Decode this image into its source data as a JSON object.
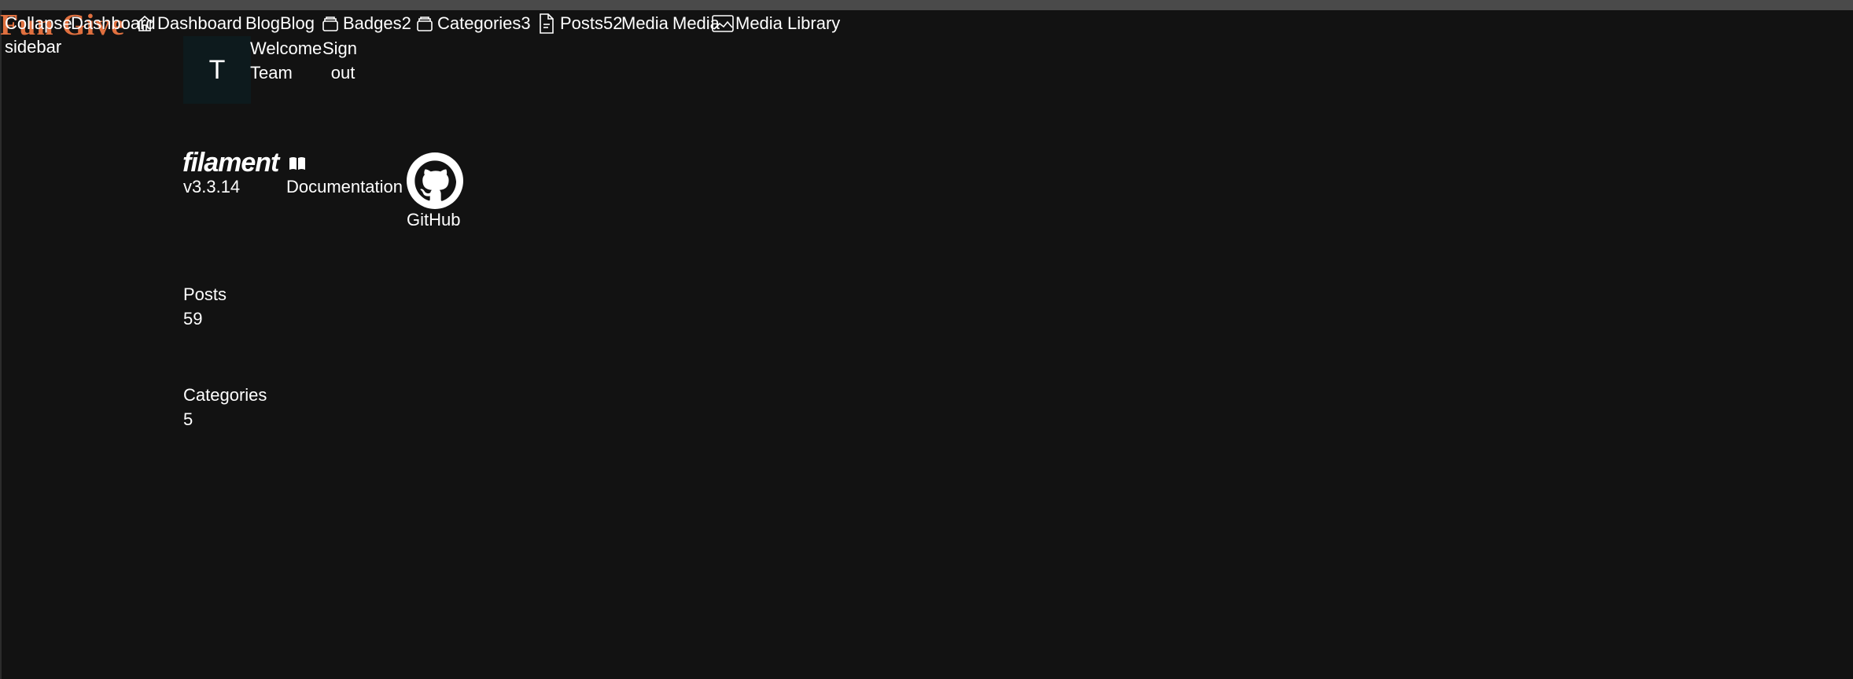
{
  "brand": {
    "logo_text": "Fun Give"
  },
  "sidebar": {
    "collapse_label": "Collapse sidebar",
    "items": [
      {
        "label": "Dashboard",
        "badge": ""
      },
      {
        "label": "Dashboard",
        "badge": ""
      },
      {
        "label": "Blog",
        "badge": ""
      },
      {
        "label": "Blog",
        "badge": ""
      },
      {
        "label": "Badges",
        "badge": "2"
      },
      {
        "label": "Categories",
        "badge": "3"
      },
      {
        "label": "Posts",
        "badge": "52"
      },
      {
        "label": "Media",
        "badge": ""
      },
      {
        "label": "Media",
        "badge": ""
      },
      {
        "label": "Media Library",
        "badge": ""
      }
    ]
  },
  "account": {
    "avatar_initial": "T",
    "welcome": "Welcome",
    "team": "Team",
    "sign_out_1": "Sign",
    "sign_out_2": "out"
  },
  "filament": {
    "logo": "filament",
    "version": "v3.3.14",
    "documentation_label": "Documentation",
    "github_label": "GitHub"
  },
  "stats": [
    {
      "label": "Posts",
      "value": "59"
    },
    {
      "label": "Categories",
      "value": "5"
    }
  ],
  "icons": [
    "collapse-icon",
    "home-icon",
    "stack-icon",
    "document-icon",
    "image-icon",
    "book-icon",
    "github-icon"
  ],
  "colors": {
    "background": "#121212",
    "text": "#ffffff",
    "brand": "#e0703f",
    "avatar_bg": "#0d1a1d"
  }
}
